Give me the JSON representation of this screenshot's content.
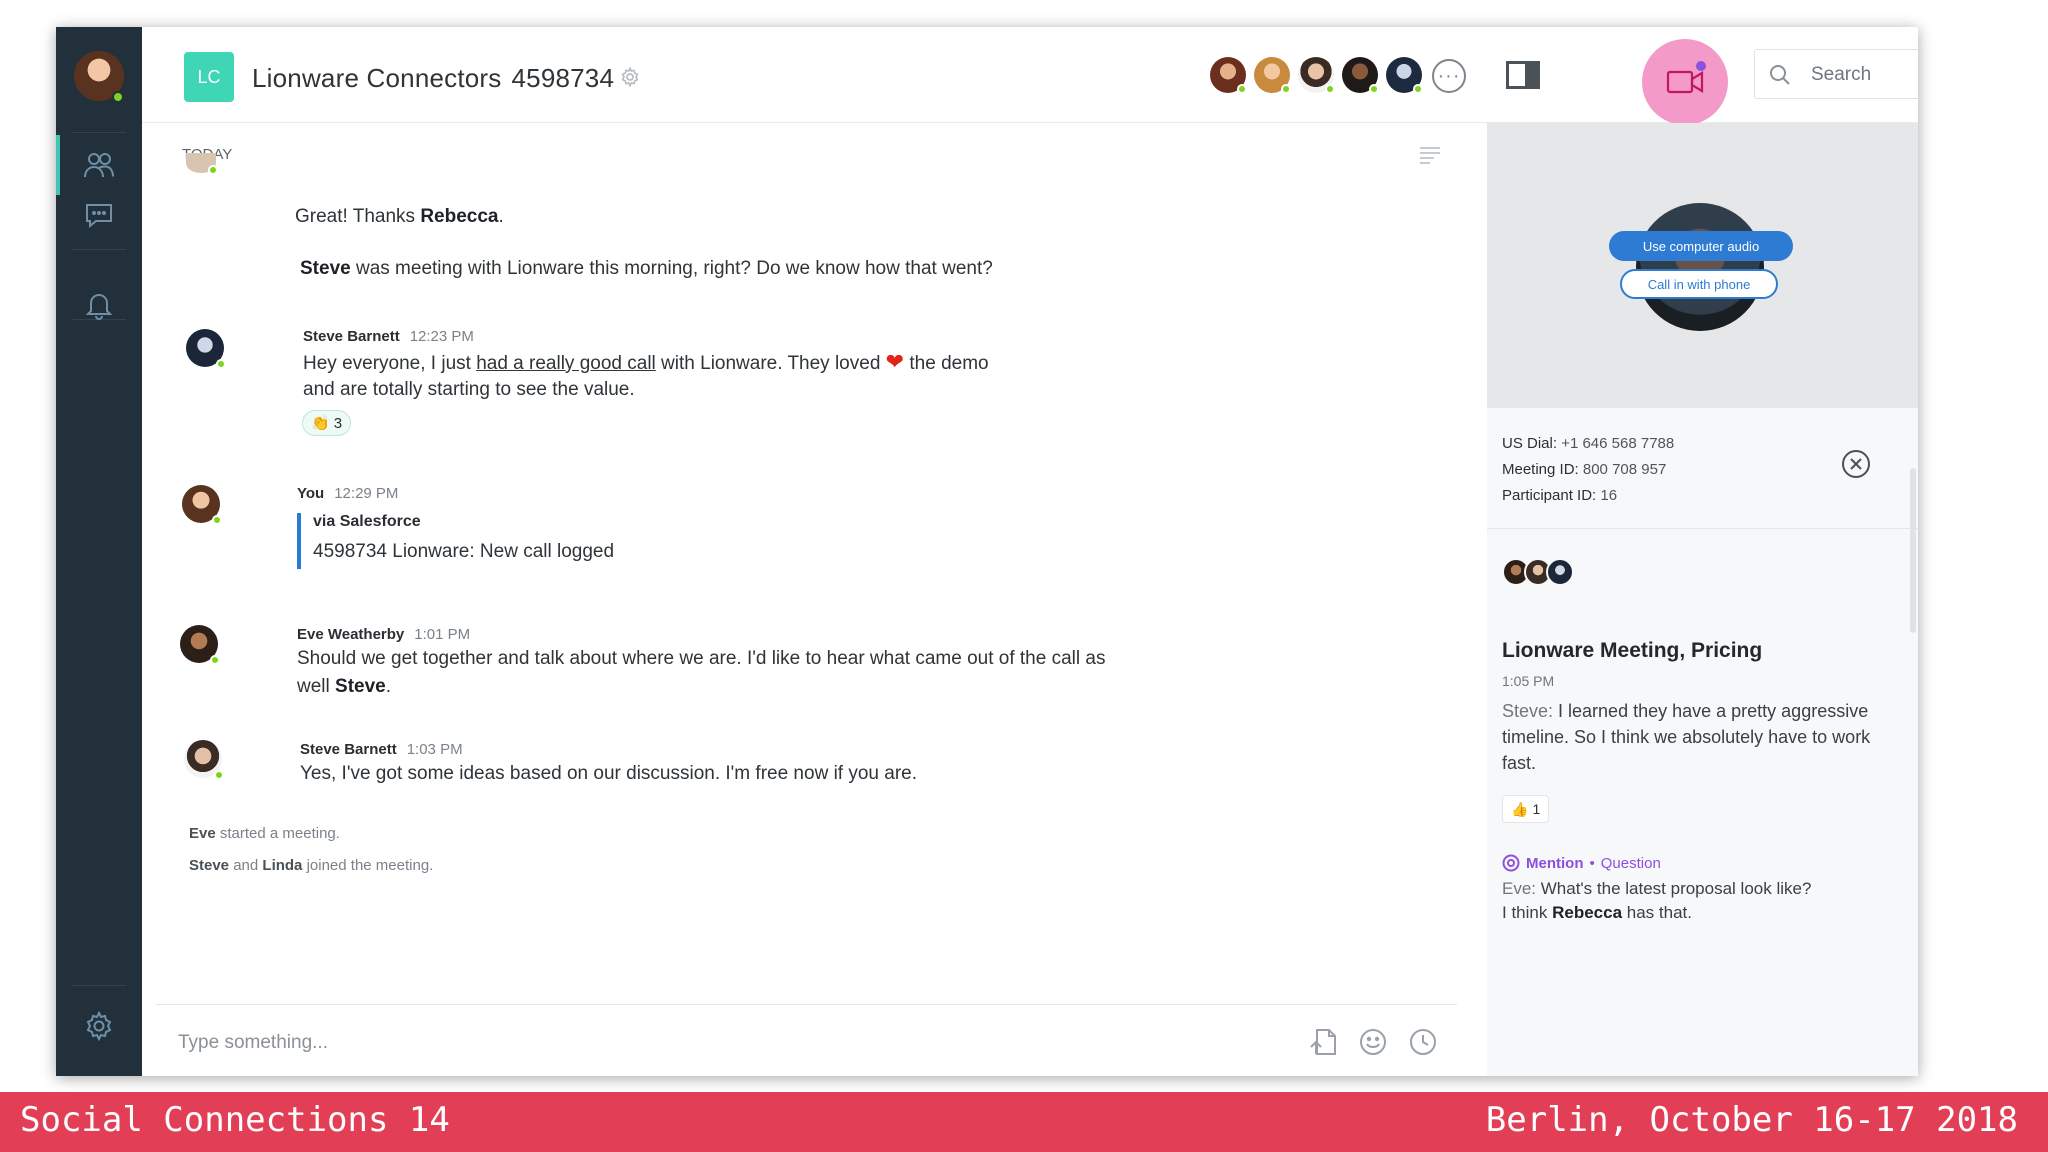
{
  "header": {
    "badge": "LC",
    "room_name": "Lionware Connectors",
    "room_id": "4598734",
    "more_label": "···",
    "search_placeholder": "Search"
  },
  "chat": {
    "day_label": "TODAY",
    "first_message": {
      "prefix": "Great! Thanks ",
      "bold": "Rebecca",
      "suffix": "."
    },
    "followup": {
      "bold": "Steve",
      "text": " was meeting with Lionware this morning, right?  Do we know how that went?"
    },
    "msg_steve1": {
      "name": "Steve Barnett",
      "time": "12:23 PM",
      "line1_pre": "Hey everyone, I just ",
      "line1_link": "had a really good call",
      "line1_mid": " with Lionware.  They loved ",
      "heart": "❤",
      "line1_post": " the demo",
      "line2": "and are totally starting to see the value.",
      "reaction_emoji": "👏",
      "reaction_count": "3"
    },
    "msg_you": {
      "name": "You",
      "time": "12:29 PM",
      "via": "via Salesforce",
      "quote": "4598734 Lionware: New call logged"
    },
    "msg_eve": {
      "name": "Eve Weatherby",
      "time": "1:01 PM",
      "line1": "Should we get together and talk about where we are.  I'd like to hear what came out of the call as",
      "line2_pre": "well ",
      "line2_bold": "Steve",
      "line2_post": "."
    },
    "msg_steve2": {
      "name": "Steve Barnett",
      "time": "1:03 PM",
      "text": "Yes, I've got some ideas based on our discussion.  I'm free now if you are."
    },
    "system1": {
      "bold": "Eve",
      "text": " started a meeting."
    },
    "system2": {
      "b1": "Steve",
      "mid": " and ",
      "b2": "Linda",
      "text": " joined the meeting."
    },
    "composer_placeholder": "Type something..."
  },
  "panel": {
    "btn_audio": "Use computer audio",
    "btn_phone": "Call in with phone",
    "us_dial_label": "US Dial:",
    "us_dial": "+1 646 568 7788",
    "meeting_id_label": "Meeting ID:",
    "meeting_id": "800 708 957",
    "participant_id_label": "Participant ID:",
    "participant_id": "16",
    "meeting_title": "Lionware Meeting, Pricing",
    "meeting_time": "1:05 PM",
    "meeting_speaker": "Steve:",
    "meeting_text": " I learned they have a pretty aggressive timeline. So I think we absolutely have to work fast.",
    "thumb_emoji": "👍",
    "thumb_count": "1",
    "mention_label": "Mention",
    "mention_sep": "•",
    "mention_type": "Question",
    "mention_speaker": "Eve:",
    "mention_line1": " What's the latest proposal look like?",
    "mention_line2_pre": "I think ",
    "mention_line2_bold": "Rebecca",
    "mention_line2_post": " has that."
  },
  "banner": {
    "left": "Social Connections 14",
    "right": "Berlin, October 16-17 2018"
  },
  "colors": {
    "sidebar": "#22303c",
    "accent": "#3ed6b4",
    "video_button": "#f49ac8",
    "link_blue": "#2e7bd4",
    "mention_purple": "#8e4fe0",
    "banner": "#e23f57"
  },
  "icons": [
    "people-icon",
    "chat-bubble-icon",
    "bell-icon",
    "gear-icon",
    "panel-toggle-icon",
    "video-camera-icon",
    "search-icon",
    "filter-icon",
    "attach-file-icon",
    "emoji-icon",
    "clock-icon",
    "close-circle-icon",
    "mention-icon"
  ]
}
